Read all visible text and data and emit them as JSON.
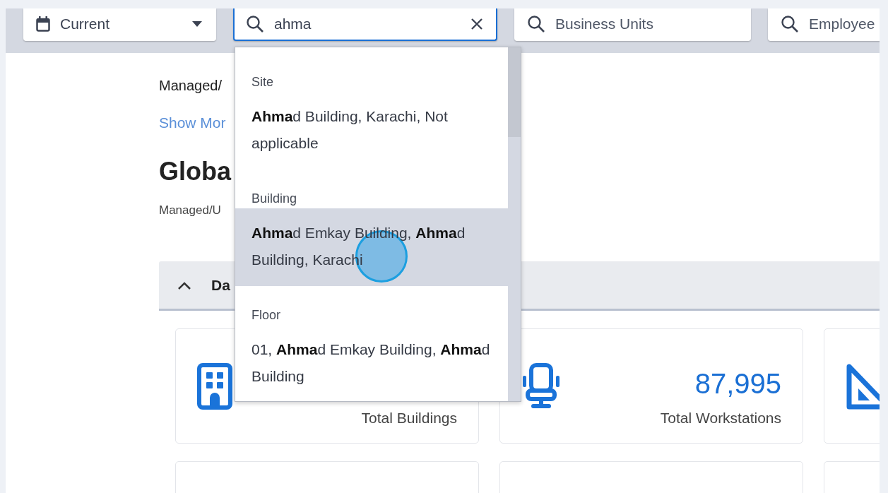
{
  "filters": [
    {
      "kind": "dropdown",
      "value": "Current",
      "focused": false
    },
    {
      "kind": "search",
      "value": "ahma",
      "focused": true
    },
    {
      "kind": "search",
      "placeholder": "Business Units",
      "focused": false
    },
    {
      "kind": "search",
      "placeholder": "Employee",
      "focused": false
    }
  ],
  "header": {
    "subtitle": "Managed/",
    "link": "Show Mor",
    "title": "Globa",
    "caption": "Managed/U"
  },
  "section": {
    "title": "Da",
    "expanded": true
  },
  "cards": [
    {
      "kind": "stat",
      "label": "Total Buildings"
    },
    {
      "kind": "stat",
      "value": "87,995",
      "label": "Total Workstations"
    },
    {
      "kind": "stat"
    },
    {
      "kind": "blank"
    },
    {
      "kind": "blank"
    },
    {
      "kind": "blank"
    }
  ],
  "suggestions": [
    {
      "label": "Site",
      "items": [
        {
          "text": "**Ahma**d Building, Karachi, Not applicable",
          "selected": false
        }
      ]
    },
    {
      "label": "Building",
      "items": [
        {
          "text": "**Ahma**d Emkay Building, **Ahma**d Building, Karachi",
          "selected": true
        }
      ]
    },
    {
      "label": "Floor",
      "items": [
        {
          "text": "01, **Ahma**d Emkay Building, **Ahma**d Building",
          "selected": false
        }
      ]
    }
  ]
}
